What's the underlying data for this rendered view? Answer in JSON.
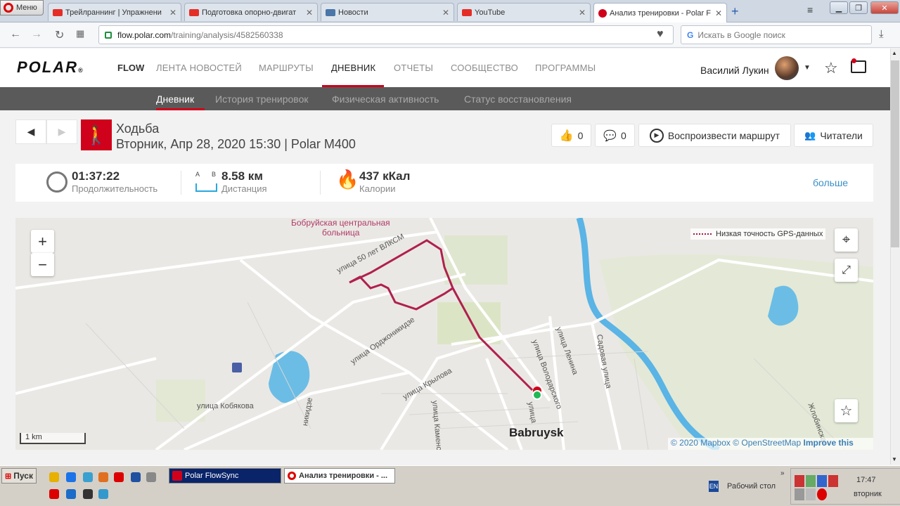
{
  "browser": {
    "menu_label": "Меню",
    "tabs": [
      {
        "label": "Трейлраннинг | Упражнени",
        "icon": "youtube-icon"
      },
      {
        "label": "Подготовка опорно-двигат",
        "icon": "youtube-icon"
      },
      {
        "label": "Новости",
        "icon": "vk-icon"
      },
      {
        "label": "YouTube",
        "icon": "youtube-icon"
      },
      {
        "label": "Анализ тренировки - Polar F",
        "icon": "polar-icon"
      }
    ],
    "url_host": "flow.polar.com",
    "url_path": "/training/analysis/4582560338",
    "search_placeholder": "Искать в Google поиск",
    "search_logo": "G"
  },
  "site": {
    "logo_text": "POLAR",
    "logo_mark": "®",
    "flow_label": "FLOW",
    "nav": [
      "ЛЕНТА НОВОСТЕЙ",
      "МАРШРУТЫ",
      "ДНЕВНИК",
      "ОТЧЕТЫ",
      "СООБЩЕСТВО",
      "ПРОГРАММЫ"
    ],
    "active_nav": "ДНЕВНИК",
    "user_name": "Василий Лукин",
    "subnav": [
      "Дневник",
      "История тренировок",
      "Физическая активность",
      "Статус восстановления"
    ],
    "active_subnav": "Дневник"
  },
  "activity": {
    "title": "Ходьба",
    "subtitle": "Вторник, Апр 28, 2020 15:30 | Polar M400",
    "likes": "0",
    "comments": "0",
    "replay_label": "Воспроизвести маршрут",
    "readers_label": "Читатели"
  },
  "summary": {
    "duration_value": "01:37:22",
    "duration_label": "Продолжительность",
    "distance_a": "A",
    "distance_b": "B",
    "distance_value": "8.58 км",
    "distance_label": "Дистанция",
    "calories_value": "437 кКал",
    "calories_label": "Калории",
    "more_label": "больше"
  },
  "map": {
    "zoom_in": "+",
    "zoom_out": "−",
    "gps_legend": "Низкая точность GPS-данных",
    "scale_label": "1 km",
    "attribution_1": "© 2020 Mapbox",
    "attribution_2": "© OpenStreetMap",
    "attribution_3": "Improve this map",
    "labels": {
      "hospital_1": "Бобруйская центральная",
      "hospital_2": "больница",
      "street_50": "улица 50 лет ВЛКСМ",
      "street_ordzh": "улица Орджоникидзе",
      "street_krylova": "улица Крылова",
      "street_kobyakova": "улица Кобякова",
      "street_lenina": "улица Ленина",
      "street_volodarskogo": "улица Володарского",
      "street_sadovaya": "Садовая улица",
      "street_kamenskogo": "улица Каменско",
      "street_zhlobinskaya": "Жлобинская",
      "street_nikidze": "никидзе",
      "street_ulitsa": "улица",
      "city": "Babruysk"
    }
  },
  "taskbar": {
    "start_label": "Пуск",
    "tasks": [
      "Polar FlowSync",
      "Анализ тренировки - ..."
    ],
    "lang": "EN",
    "desktop_label": "Рабочий стол",
    "time": "17:47",
    "day": "вторник"
  },
  "colors": {
    "brand_red": "#d0021b",
    "route": "#b0204f",
    "link_blue": "#3a8fc8",
    "water": "#5ab4e5"
  }
}
